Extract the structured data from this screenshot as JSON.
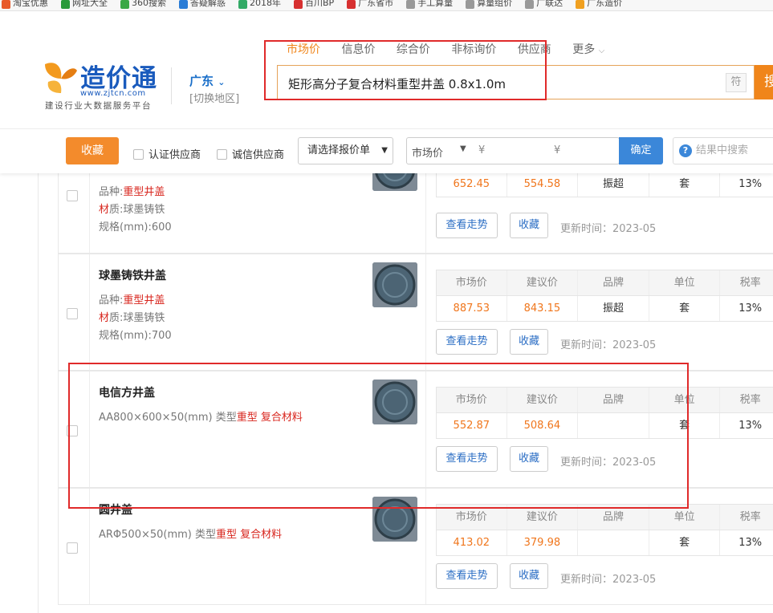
{
  "bookmarks": [
    {
      "label": "淘宝优惠",
      "color": "#e85a2a"
    },
    {
      "label": "网址大全",
      "color": "#2a9a3a"
    },
    {
      "label": "360搜索",
      "color": "#3aa846"
    },
    {
      "label": "答疑解惑",
      "color": "#2a7cd6"
    },
    {
      "label": "2018年",
      "color": "#33aa66"
    },
    {
      "label": "百川BP",
      "color": "#d73030"
    },
    {
      "label": "广东省市",
      "color": "#d73030"
    },
    {
      "label": "手工算量",
      "color": "#999999"
    },
    {
      "label": "算量组价",
      "color": "#999999"
    },
    {
      "label": "广联达",
      "color": "#999999"
    },
    {
      "label": "广东造价",
      "color": "#f0a020"
    }
  ],
  "header": {
    "logo_text": "造价通",
    "logo_url": "www.zjtcn.com",
    "logo_slogan": "建设行业大数据服务平台",
    "region": "广东",
    "region_switch": "[切换地区]",
    "nav": [
      "市场价",
      "信息价",
      "综合价",
      "非标询价",
      "供应商",
      "更多"
    ],
    "search_value": "矩形高分子复合材料重型井盖 0.8x1.0m",
    "symbol_button": "符",
    "search_button": "搜"
  },
  "filter": {
    "favorite_button": "收藏",
    "certified_supplier": "认证供应商",
    "trusted_supplier": "诚信供应商",
    "quote_select": "请选择报价单",
    "price_type": "市场价",
    "price_min_symbol": "¥",
    "price_max_symbol": "¥",
    "confirm_button": "确定",
    "result_search_placeholder": "结果中搜索"
  },
  "columns": [
    "市场价",
    "建议价",
    "品牌",
    "单位",
    "税率"
  ],
  "products": [
    {
      "name": "",
      "attrs": [
        {
          "label": "品种:",
          "value": "重型井盖",
          "red": true
        },
        {
          "label": "材质:",
          "value": "球墨铸铁",
          "red": false,
          "label_red_prefix": "材"
        },
        {
          "label": "规格(mm):",
          "value": "600",
          "red": false
        }
      ],
      "market_price": "652.45",
      "suggested_price": "554.58",
      "brand": "振超",
      "unit": "套",
      "tax": "13%",
      "trend_button": "查看走势",
      "favorite_button": "收藏",
      "updated": "更新时间：2023-05"
    },
    {
      "name": "球墨铸铁井盖",
      "attrs": [
        {
          "label": "品种:",
          "value": "重型井盖",
          "red": true
        },
        {
          "label": "材质:",
          "value": "球墨铸铁",
          "red": false,
          "label_red_prefix": "材"
        },
        {
          "label": "规格(mm):",
          "value": "700",
          "red": false
        }
      ],
      "market_price": "887.53",
      "suggested_price": "843.15",
      "brand": "振超",
      "unit": "套",
      "tax": "13%",
      "trend_button": "查看走势",
      "favorite_button": "收藏",
      "updated": "更新时间：2023-05"
    },
    {
      "name": "电信方井盖",
      "spec_prefix": "AA800×600×50(mm) 类型",
      "spec_red1": "重型",
      "spec_red2": "复合材料",
      "market_price": "552.87",
      "suggested_price": "508.64",
      "brand": "",
      "unit": "套",
      "tax": "13%",
      "trend_button": "查看走势",
      "favorite_button": "收藏",
      "updated": "更新时间：2023-05"
    },
    {
      "name": "圆井盖",
      "spec_prefix": "ARΦ500×50(mm) 类型",
      "spec_red1": "重型",
      "spec_red2": "复合材料",
      "market_price": "413.02",
      "suggested_price": "379.98",
      "brand": "",
      "unit": "套",
      "tax": "13%",
      "trend_button": "查看走势",
      "favorite_button": "收藏",
      "updated": "更新时间：2023-05"
    }
  ],
  "colors": {
    "accent": "#f0851a",
    "link": "#2a6dc4",
    "annotation": "#e02a2a",
    "price": "#f0761c"
  }
}
